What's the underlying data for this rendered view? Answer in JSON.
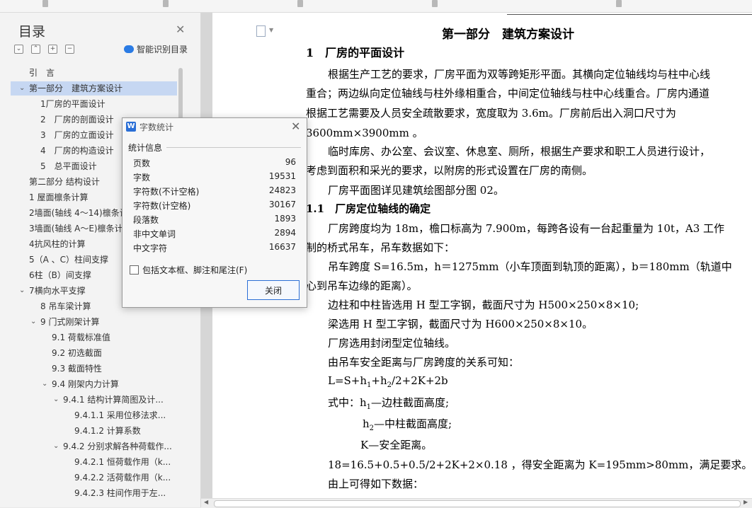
{
  "toc": {
    "title": "目录",
    "smart_toc_label": "智能识别目录",
    "items": [
      {
        "label": "引　言",
        "level": 0,
        "arrow": ""
      },
      {
        "label": "第一部分　建筑方案设计",
        "level": 0,
        "arrow": "v",
        "selected": true
      },
      {
        "label": "1厂房的平面设计",
        "level": 1,
        "arrow": ""
      },
      {
        "label": "2　厂房的剖面设计",
        "level": 1,
        "arrow": ""
      },
      {
        "label": "3　厂房的立面设计",
        "level": 1,
        "arrow": ""
      },
      {
        "label": "4　厂房的构造设计",
        "level": 1,
        "arrow": ""
      },
      {
        "label": "5　总平面设计",
        "level": 1,
        "arrow": ""
      },
      {
        "label": "第二部分 结构设计",
        "level": 0,
        "arrow": ""
      },
      {
        "label": "1 屋面檩条计算",
        "level": 0,
        "arrow": ""
      },
      {
        "label": "2墙面(轴线 4～14)檩条计",
        "level": 0,
        "arrow": ""
      },
      {
        "label": "3墙面(轴线 A～E)檩条计",
        "level": 0,
        "arrow": ""
      },
      {
        "label": "4抗风柱的计算",
        "level": 0,
        "arrow": ""
      },
      {
        "label": "5（A 、C）柱间支撑",
        "level": 0,
        "arrow": ""
      },
      {
        "label": "6柱（B）间支撑",
        "level": 0,
        "arrow": ""
      },
      {
        "label": "7横向水平支撑",
        "level": 0,
        "arrow": "v"
      },
      {
        "label": "8 吊车梁计算",
        "level": 1,
        "arrow": ""
      },
      {
        "label": "9 门式刚架计算",
        "level": 1,
        "arrow": "v"
      },
      {
        "label": "9.1 荷载标准值",
        "level": 2,
        "arrow": ""
      },
      {
        "label": "9.2 初选截面",
        "level": 2,
        "arrow": ""
      },
      {
        "label": "9.3 截面特性",
        "level": 2,
        "arrow": ""
      },
      {
        "label": "9.4 刚架内力计算",
        "level": 2,
        "arrow": "v"
      },
      {
        "label": "9.4.1 结构计算简图及计...",
        "level": 3,
        "arrow": "v"
      },
      {
        "label": "9.4.1.1 采用位移法求...",
        "level": 4,
        "arrow": ""
      },
      {
        "label": "9.4.1.2 计算系数",
        "level": 4,
        "arrow": ""
      },
      {
        "label": "9.4.2 分别求解各种荷载作...",
        "level": 3,
        "arrow": "v"
      },
      {
        "label": "9.4.2.1 恒荷载作用（k...",
        "level": 4,
        "arrow": ""
      },
      {
        "label": "9.4.2.2 活荷载作用（k...",
        "level": 4,
        "arrow": ""
      },
      {
        "label": "9.4.2.3 柱间作用于左...",
        "level": 4,
        "arrow": ""
      }
    ]
  },
  "document": {
    "title": "第一部分　建筑方案设计",
    "h1": "1　厂房的平面设计",
    "p1": [
      "根据生产工艺的要求，厂房平面为双等跨矩形平面。其横向定位轴线均与柱中心线",
      "重合；两边纵向定位轴线与柱外缘相重合，中间定位轴线与柱中心线重合。厂房内通道",
      "根据工艺需要及人员安全疏散要求，宽度取为 3.6m。厂房前后出入洞口尺寸为",
      "3600mm×3900mm 。"
    ],
    "p2": [
      "临时库房、办公室、会议室、休息室、厕所，根据生产要求和职工人员进行设计，",
      "考虑到面积和采光的要求，以附房的形式设置在厂房的南侧。"
    ],
    "p3": "厂房平面图详见建筑绘图部分图 02。",
    "h2": "1.1　厂房定位轴线的确定",
    "p4": [
      "厂房跨度均为 18m，檐口标高为 7.900m，每跨各设有一台起重量为 10t，A3 工作",
      "制的桥式吊车，吊车数据如下："
    ],
    "p5": [
      "吊车跨度 S=16.5m，h＝1275mm（小车顶面到轨顶的距离），b＝180mm（轨道中",
      "心到吊车边缘的距离）。"
    ],
    "p6": "边柱和中柱皆选用 H 型工字钢，截面尺寸为 H500×250×8×10;",
    "p7": "梁选用 H 型工字钢，截面尺寸为 H600×250×8×10。",
    "p8": "厂房选用封闭型定位轴线。",
    "p9": "由吊车安全距离与厂房跨度的关系可知：",
    "formula": {
      "a": "L=S+h",
      "s1": "1",
      "b": "+h",
      "s2": "2",
      "c": "/2+2K+2b"
    },
    "where": {
      "a": "式中：h",
      "s": "1",
      "b": "—边柱截面高度;"
    },
    "h2def": {
      "a": "h",
      "s": "2",
      "b": "—中柱截面高度;"
    },
    "kdef": "K—安全距离。",
    "calc": "18=16.5+0.5+0.5/2+2K+2×0.18 ，得安全距离为 K=195mm>80mm，满足要求。",
    "last": "由上可得如下数据："
  },
  "dialog": {
    "title": "字数统计",
    "section": "统计信息",
    "rows": [
      {
        "label": "页数",
        "value": "96"
      },
      {
        "label": "字数",
        "value": "19531"
      },
      {
        "label": "字符数(不计空格)",
        "value": "24823"
      },
      {
        "label": "字符数(计空格)",
        "value": "30167"
      },
      {
        "label": "段落数",
        "value": "1893"
      },
      {
        "label": "非中文单词",
        "value": "2894"
      },
      {
        "label": "中文字符",
        "value": "16637"
      }
    ],
    "checkbox_label": "包括文本框、脚注和尾注(F)",
    "close_label": "关闭"
  }
}
